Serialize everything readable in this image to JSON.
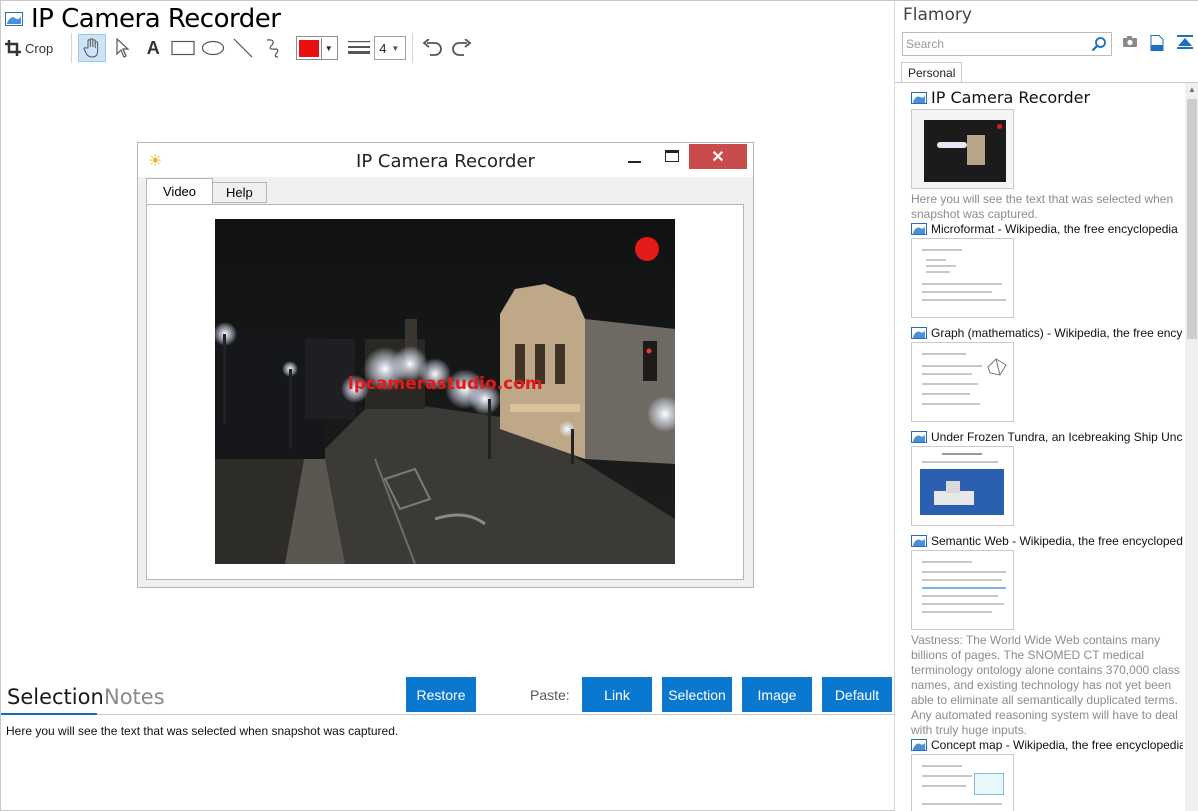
{
  "app": {
    "title": "IP Camera Recorder"
  },
  "toolbar": {
    "crop_label": "Crop",
    "color": "#e81010",
    "line_width": "4"
  },
  "captured_window": {
    "title": "IP Camera Recorder",
    "close_glyph": "✕",
    "tabs": [
      {
        "label": "Video"
      },
      {
        "label": "Help"
      }
    ],
    "watermark": "ipcamerastudio.com"
  },
  "bottom": {
    "tabs": [
      {
        "label": "Selection"
      },
      {
        "label": "Notes"
      }
    ],
    "restore_label": "Restore",
    "paste_label": "Paste:",
    "paste_buttons": [
      {
        "label": "Link"
      },
      {
        "label": "Selection"
      },
      {
        "label": "Image"
      },
      {
        "label": "Default"
      }
    ],
    "selection_text": "Here you will see the text that was selected when snapshot was captured."
  },
  "side": {
    "title": "Flamory",
    "search_placeholder": "Search",
    "tab": "Personal",
    "entries": [
      {
        "title": "IP Camera Recorder",
        "desc": "Here you will see the text that was selected when snapshot was captured."
      },
      {
        "title": "Microformat - Wikipedia, the free encyclopedia"
      },
      {
        "title": "Graph (mathematics) - Wikipedia, the free ency"
      },
      {
        "title": "Under Frozen Tundra, an Icebreaking Ship Unco"
      },
      {
        "title": "Semantic Web - Wikipedia, the free encycloped",
        "desc": "Vastness: The World Wide Web contains many billions of pages. The SNOMED CT medical terminology ontology alone contains 370,000 class names, and existing technology has not yet been able to eliminate all semantically duplicated terms. Any automated reasoning system will have to deal with truly huge inputs."
      },
      {
        "title": "Concept map - Wikipedia, the free encyclopedia"
      }
    ]
  },
  "colors": {
    "accent": "#0b78d0",
    "close_red": "#c94b4b",
    "record_red": "#e51a1a"
  }
}
